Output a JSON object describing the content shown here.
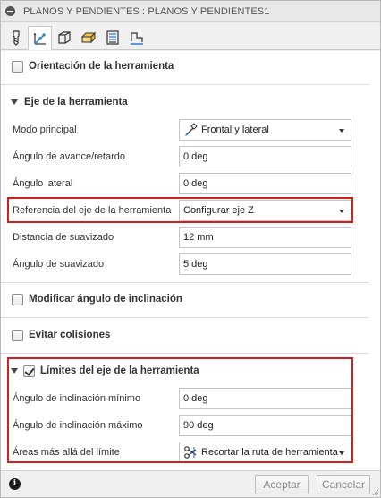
{
  "title": "PLANOS Y PENDIENTES : PLANOS Y PENDIENTES1",
  "tabs": [
    {
      "icon": "tool-icon",
      "active": false
    },
    {
      "icon": "tool-axis-icon",
      "active": true
    },
    {
      "icon": "geometry-box-icon",
      "active": false
    },
    {
      "icon": "heights-icon",
      "active": false
    },
    {
      "icon": "passes-icon",
      "active": false
    },
    {
      "icon": "linking-icon",
      "active": false
    }
  ],
  "sections": {
    "orientation": {
      "label": "Orientación de la herramienta",
      "checked": false
    },
    "tool_axis": {
      "label": "Eje de la herramienta"
    },
    "modify_tilt": {
      "label": "Modificar ángulo de inclinación",
      "checked": false
    },
    "avoid_collisions": {
      "label": "Evitar colisiones",
      "checked": false
    },
    "axis_limits": {
      "label": "Límites del eje de la herramienta",
      "checked": true
    }
  },
  "tool_axis": {
    "main_mode": {
      "label": "Modo principal",
      "value": "Frontal y lateral"
    },
    "lead_lag": {
      "label": "Ángulo de avance/retardo",
      "value": "0 deg"
    },
    "side_angle": {
      "label": "Ángulo lateral",
      "value": "0 deg"
    },
    "axis_reference": {
      "label": "Referencia del eje de la herramienta",
      "value": "Configurar eje Z"
    },
    "smoothing_distance": {
      "label": "Distancia de suavizado",
      "value": "12 mm"
    },
    "smoothing_angle": {
      "label": "Ángulo de suavizado",
      "value": "5 deg"
    }
  },
  "limits": {
    "min_tilt": {
      "label": "Ángulo de inclinación mínimo",
      "value": "0 deg"
    },
    "max_tilt": {
      "label": "Ángulo de inclinación máximo",
      "value": "90 deg"
    },
    "beyond_limit": {
      "label": "Áreas más allá del límite",
      "value": "Recortar la ruta de herramienta"
    }
  },
  "footer": {
    "info_icon": "i",
    "ok_label": "Aceptar",
    "cancel_label": "Cancelar"
  },
  "colors": {
    "highlight": "#d41f1f"
  }
}
